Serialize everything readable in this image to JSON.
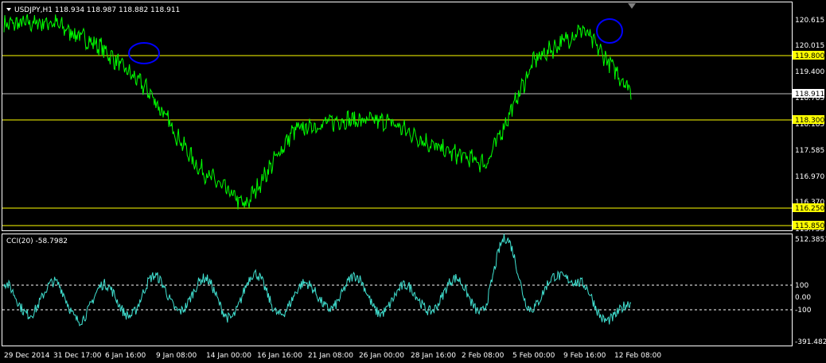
{
  "header": {
    "symbol_line": "USDJPY,H1  118.934 118.987 118.882 118.911",
    "indicator_line": "CCI(20) -58.7982"
  },
  "colors": {
    "background": "#000000",
    "frame": "#ffffff",
    "price_line": "#00ff00",
    "cci_line": "#40e0d0",
    "hline": "#ffff00",
    "current_price_line": "#c0c0c0",
    "ellipse": "#0000ff"
  },
  "price_axis": {
    "ticks": [
      "120.615",
      "120.015",
      "119.400",
      "118.785",
      "118.185",
      "117.585",
      "116.970",
      "116.370",
      "115.755"
    ],
    "current_price": "118.911",
    "hline_labels": [
      "119.800",
      "118.300",
      "116.250",
      "115.850"
    ]
  },
  "cci_axis": {
    "ticks": [
      "512.3851",
      "100",
      "0.00",
      "-100",
      "-391.4824"
    ]
  },
  "time_axis": {
    "labels": [
      "29 Dec 2014",
      "31 Dec 17:00",
      "6 Jan 16:00",
      "9 Jan 08:00",
      "14 Jan 00:00",
      "16 Jan 16:00",
      "21 Jan 08:00",
      "26 Jan 00:00",
      "28 Jan 16:00",
      "2 Feb 08:00",
      "5 Feb 00:00",
      "9 Feb 16:00",
      "12 Feb 08:00"
    ]
  },
  "chart_data": [
    {
      "type": "line",
      "title": "USDJPY,H1",
      "ylim": [
        115.75,
        120.9
      ],
      "horizontal_levels": [
        119.8,
        118.3,
        116.25,
        115.85
      ],
      "current_price": 118.911,
      "x": [
        "29 Dec 2014",
        "31 Dec 17:00",
        "6 Jan 16:00",
        "9 Jan 08:00",
        "14 Jan 00:00",
        "16 Jan 16:00",
        "21 Jan 08:00",
        "26 Jan 00:00",
        "28 Jan 16:00",
        "2 Feb 08:00",
        "5 Feb 00:00",
        "9 Feb 16:00",
        "12 Feb 08:00"
      ],
      "series": [
        {
          "values": [
            120.4,
            120.45,
            119.9,
            118.9,
            117.2,
            116.3,
            118.0,
            118.25,
            118.2,
            117.6,
            117.25,
            119.6,
            120.3,
            118.91
          ]
        }
      ],
      "annotations": [
        "circle near 6 Jan high",
        "circle near 10 Feb high"
      ]
    },
    {
      "type": "line",
      "title": "CCI(20)",
      "ylim": [
        -391.4824,
        512.3851
      ],
      "reference_levels": [
        100,
        -100
      ],
      "series": [
        {
          "values": [
            120,
            -150,
            130,
            -200,
            110,
            -160,
            180,
            -120,
            160,
            -180,
            200,
            -150,
            120,
            -100,
            180,
            -140,
            100,
            -120,
            160,
            -130,
            500,
            -100,
            180,
            120,
            -200,
            -50
          ]
        }
      ]
    }
  ]
}
